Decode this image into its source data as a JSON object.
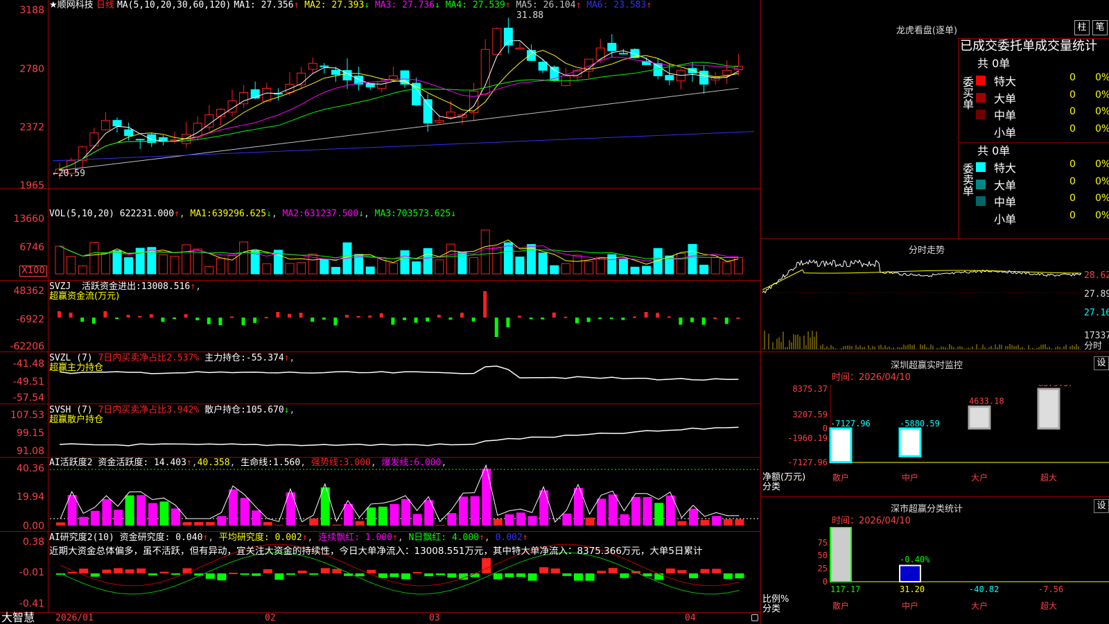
{
  "app": {
    "title_mark": "★",
    "stock_name": "顺网科技",
    "period": "日线",
    "brand": "大智慧"
  },
  "colors": {
    "up": "#ff2020",
    "down": "#00ffff",
    "ma1": "#ffffff",
    "ma2": "#ffff00",
    "ma3": "#ff00ff",
    "ma4": "#00ff00",
    "ma5": "#c0c0c0",
    "ma6": "#0000ff",
    "axis": "#a00000"
  },
  "main": {
    "ma_label": "MA(5,10,20,30,60,120)",
    "ma": [
      {
        "k": "MA1:",
        "v": "27.356",
        "arrow": "↑",
        "color": "#ffffff"
      },
      {
        "k": "MA2:",
        "v": "27.393",
        "arrow": "↓",
        "color": "#ffff00"
      },
      {
        "k": "MA3:",
        "v": "27.736",
        "arrow": "↓",
        "color": "#ff00ff"
      },
      {
        "k": "MA4:",
        "v": "27.539",
        "arrow": "↑",
        "color": "#00ff00"
      },
      {
        "k": "MA5:",
        "v": "26.104",
        "arrow": "↑",
        "color": "#c0c0c0"
      },
      {
        "k": "MA6:",
        "v": "23.583",
        "arrow": "↑",
        "color": "#3030ff"
      }
    ],
    "y_ticks": [
      "3188",
      "2780",
      "2372",
      "1965"
    ],
    "high_label": "31.88",
    "low_label": "20.59"
  },
  "vol": {
    "label": "VOL(5,10,20)",
    "value": "622231.000",
    "arrow": "↑",
    "ma": [
      {
        "k": "MA1:",
        "v": "639296.625",
        "arrow": "↓"
      },
      {
        "k": "MA2:",
        "v": "631237.500",
        "arrow": "↓"
      },
      {
        "k": "MA3:",
        "v": "703573.625",
        "arrow": "↓"
      }
    ],
    "y_ticks": [
      "13660",
      "6746"
    ],
    "unit": "X100"
  },
  "svzj": {
    "label": "SVZJ",
    "desc": "活跃资金进出:",
    "value": "13008.516",
    "arrow": "↑",
    "sub": "超赢资金流(万元)",
    "y_ticks": [
      "48362",
      "-6922",
      "-62206"
    ]
  },
  "svzl": {
    "label": "SVZL (7)",
    "desc": "7日内买卖净占比2.537%",
    "hold": "主力持仓:",
    "hold_v": "-55.374",
    "arrow": "↑",
    "sub": "超赢主力持仓",
    "y_ticks": [
      "-41.48",
      "-49.51",
      "-57.54"
    ]
  },
  "svsh": {
    "label": "SVSH (7)",
    "desc": "7日内买卖净占比3.942%",
    "hold": "散户持仓:",
    "hold_v": "105.670",
    "arrow": "↓",
    "sub": "超赢散户持仓",
    "y_ticks": [
      "107.53",
      "99.15",
      "91.08"
    ]
  },
  "ai1": {
    "label": "AI活跃度2",
    "desc": "资金活跃度:",
    "v1": "14.403",
    "a1": "↑",
    "v2": "40.358",
    "life": "生命线:",
    "v3": "1.560",
    "strong": "强势线:",
    "v4": "3.000",
    "burst": "爆发线:",
    "v5": "6.000",
    "y_ticks": [
      "40.36",
      "19.94",
      "0.00"
    ]
  },
  "ai2": {
    "label": "AI研究度2(10)",
    "desc": "资金研究度:",
    "v1": "0.040",
    "a1": "↑",
    "avg": "平均研究度:",
    "v2": "0.002",
    "a2": "↑",
    "cont": "连续飘红:",
    "v3": "1.000",
    "a3": "↑",
    "nday": "N日飘红:",
    "v4": "4.000",
    "a4": "↑",
    "v5": "0.002",
    "a5": "↑",
    "text": "近期大资金总体偏多，虽不活跃，但有异动，宜关注大资金的持续性，今日大单净流入：13008.551万元，其中特大单净流入：8375.366万元，大单5日累计",
    "y_ticks": [
      "0.38",
      "-0.01",
      "-0.41"
    ]
  },
  "x_axis": [
    "2026/01",
    "02",
    "03",
    "04"
  ],
  "dragon": {
    "title": "龙虎看盘(逐单)",
    "btn1": "柱",
    "btn2": "笔",
    "header": "已成交委托单成交量统计",
    "buy": {
      "side": "委买单",
      "total": "共 0单",
      "rows": [
        {
          "name": "特大",
          "n": "0",
          "p": "0%",
          "color": "#ff0000"
        },
        {
          "name": "大单",
          "n": "0",
          "p": "0%",
          "color": "#a00000"
        },
        {
          "name": "中单",
          "n": "0",
          "p": "0%",
          "color": "#700000"
        },
        {
          "name": "小单",
          "n": "0",
          "p": "0%",
          "color": "#000000"
        }
      ]
    },
    "sell": {
      "side": "委卖单",
      "total": "共 0单",
      "rows": [
        {
          "name": "特大",
          "n": "0",
          "p": "0%",
          "color": "#00ffff"
        },
        {
          "name": "大单",
          "n": "0",
          "p": "0%",
          "color": "#008888"
        },
        {
          "name": "中单",
          "n": "0",
          "p": "0%",
          "color": "#006666"
        },
        {
          "name": "小单",
          "n": "0",
          "p": "0%",
          "color": "#000000"
        }
      ]
    }
  },
  "intraday": {
    "title": "分时走势",
    "p1": "28.62",
    "p2": "27.89",
    "p3": "27.16",
    "vol": "17337",
    "tab": "分时"
  },
  "monitor": {
    "title": "深圳超赢实时监控",
    "set": "设",
    "time": "时间：2026/04/10",
    "y_ticks": [
      "8375.37",
      "3207.59",
      "0",
      "-1960.19",
      "-7127.96"
    ],
    "ylabel1": "净额(万元)",
    "ylabel2": "分类",
    "bars": [
      {
        "cat": "散户",
        "value": "-7127.96"
      },
      {
        "cat": "中户",
        "value": "-5880.59"
      },
      {
        "cat": "大户",
        "value": "4633.18"
      },
      {
        "cat": "超大",
        "value": "8375.37"
      }
    ]
  },
  "classify": {
    "title": "深市超赢分类统计",
    "set": "设",
    "time": "时间：2026/04/10",
    "y_ticks": [
      "75",
      "50",
      "25",
      "0"
    ],
    "ylabel1": "比例%",
    "ylabel2": "分类",
    "bars": [
      {
        "cat": "散户",
        "value": "117.17"
      },
      {
        "cat": "中户",
        "value": "31.20"
      },
      {
        "cat": "大户",
        "value": "-40.82"
      },
      {
        "cat": "超大",
        "value": "-7.56"
      }
    ],
    "note": "-0.40%"
  }
}
